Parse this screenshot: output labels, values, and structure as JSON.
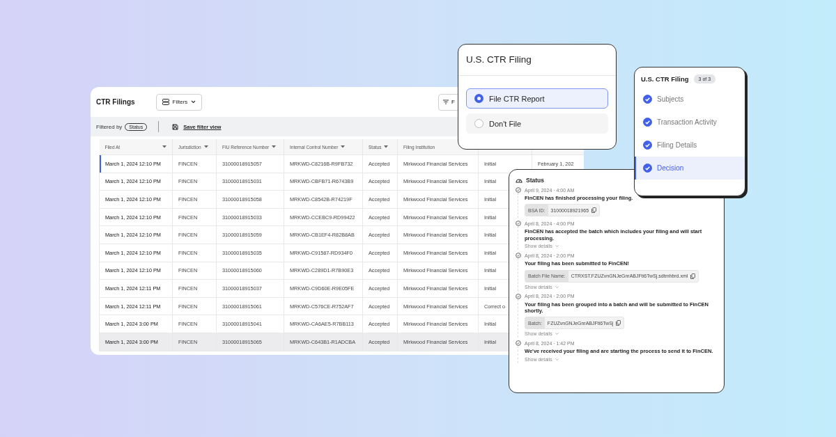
{
  "filings": {
    "title": "CTR Filings",
    "filters_button": "Filters",
    "toolbar_button": "F",
    "filtered_by": "Filtered by",
    "filter_chip": "Status",
    "save_view": "Save filter view",
    "columns": [
      {
        "label": "Filed At",
        "sortable": true
      },
      {
        "label": "Jurisdiction",
        "sortable": true
      },
      {
        "label": "FIU Reference Number",
        "sortable": true
      },
      {
        "label": "Internal Control Number",
        "sortable": true
      },
      {
        "label": "Status",
        "sortable": true
      },
      {
        "label": "Filing Institution",
        "sortable": false
      }
    ],
    "rows": [
      {
        "selected": true,
        "hovered": false,
        "cells": [
          "March 1, 2024 12:10 PM",
          "FINCEN",
          "31000018915057",
          "MRKWD-C8216B-R9FB732",
          "Accepted",
          "Mirkwood Financial Services",
          "Initial",
          "February 1, 202"
        ]
      },
      {
        "selected": false,
        "hovered": false,
        "cells": [
          "March 1, 2024 12:10 PM",
          "FINCEN",
          "31000018915031",
          "MRKWD-CBFB71-R6743B9",
          "Accepted",
          "Mirkwood Financial Services",
          "Initial"
        ]
      },
      {
        "selected": false,
        "hovered": false,
        "cells": [
          "March 1, 2024 12:10 PM",
          "FINCEN",
          "31000018915058",
          "MRKWD-C8542B-R74219F",
          "Accepted",
          "Mirkwood Financial Services",
          "Initial"
        ]
      },
      {
        "selected": false,
        "hovered": false,
        "cells": [
          "March 1, 2024 12:10 PM",
          "FINCEN",
          "31000018915033",
          "MRKWD-CCEBC9-RD99422",
          "Accepted",
          "Mirkwood Financial Services",
          "Initial"
        ]
      },
      {
        "selected": false,
        "hovered": false,
        "cells": [
          "March 1, 2024 12:10 PM",
          "FINCEN",
          "31000018915059",
          "MRKWD-CB1EF4-R82B8AB",
          "Accepted",
          "Mirkwood Financial Services",
          "Initial"
        ]
      },
      {
        "selected": false,
        "hovered": false,
        "cells": [
          "March 1, 2024 12:10 PM",
          "FINCEN",
          "31000018915035",
          "MRKWD-C91587-RD934F0",
          "Accepted",
          "Mirkwood Financial Services",
          "Initial"
        ]
      },
      {
        "selected": false,
        "hovered": false,
        "cells": [
          "March 1, 2024 12:10 PM",
          "FINCEN",
          "31000018915060",
          "MRKWD-C289D1-R7B90E3",
          "Accepted",
          "Mirkwood Financial Services",
          "Initial"
        ]
      },
      {
        "selected": false,
        "hovered": false,
        "cells": [
          "March 1, 2024 12:11 PM",
          "FINCEN",
          "31000018915037",
          "MRKWD-C9D60E-R9E05FE",
          "Accepted",
          "Mirkwood Financial Services",
          "Initial"
        ]
      },
      {
        "selected": false,
        "hovered": false,
        "cells": [
          "March 1, 2024 12:11 PM",
          "FINCEN",
          "31000018915061",
          "MRKWD-C576CE-R752AF7",
          "Accepted",
          "Mirkwood Financial Services",
          "Correct o"
        ]
      },
      {
        "selected": false,
        "hovered": false,
        "cells": [
          "March 1, 2024 3:00 PM",
          "FINCEN",
          "31000018915041",
          "MRKWD-CA6AE5-R7BB113",
          "Accepted",
          "Mirkwood Financial Services",
          "Initial"
        ]
      },
      {
        "selected": false,
        "hovered": true,
        "cells": [
          "March 1, 2024 3:00 PM",
          "FINCEN",
          "31000018915065",
          "MRKWD-C643B1-R1ADCBA",
          "Accepted",
          "Mirkwood Financial Services",
          "Initial"
        ]
      }
    ]
  },
  "decision": {
    "title": "U.S. CTR Filing",
    "options": [
      {
        "label": "File CTR Report",
        "selected": true
      },
      {
        "label": "Don't File",
        "selected": false
      }
    ]
  },
  "steps": {
    "title": "U.S. CTR Filing",
    "badge": "3 of 3",
    "items": [
      {
        "label": "Subjects",
        "done": true,
        "selected": false
      },
      {
        "label": "Transaction Activity",
        "done": true,
        "selected": false
      },
      {
        "label": "Filing Details",
        "done": true,
        "selected": false
      },
      {
        "label": "Decision",
        "done": true,
        "selected": true
      }
    ]
  },
  "status": {
    "title": "Status",
    "events": [
      {
        "time": "April 9, 2024 · 4:00 AM",
        "message": "FinCEN has finished processing your filing.",
        "chip_label": "BSA ID:",
        "chip_value": "31000018921965"
      },
      {
        "time": "April 8, 2024 · 4:00 PM",
        "message": "FinCEN has accepted the batch which includes your filing and will start processing.",
        "details": "Show details"
      },
      {
        "time": "April 8, 2024 · 2:00 PM",
        "message": "Your filing has been submitted to FinCEN!",
        "chip_label": "Batch File Name:",
        "chip_value": "CTRXST.FZUZvnGNJeGnrABJFti6TwSj.sdtmhbrd.xml",
        "details": "Show details"
      },
      {
        "time": "April 8, 2024 · 2:00 PM",
        "message": "Your filing has been grouped into a batch and will be submitted to FinCEN shortly.",
        "chip_label": "Batch:",
        "chip_value": "FZUZvnGNJeGnrABJFti6TwSj",
        "details": "Show details"
      },
      {
        "time": "April 8, 2024 · 1:42 PM",
        "message": "We've received your filing and are starting the process to send it to FinCEN.",
        "details": "Show details"
      }
    ]
  }
}
